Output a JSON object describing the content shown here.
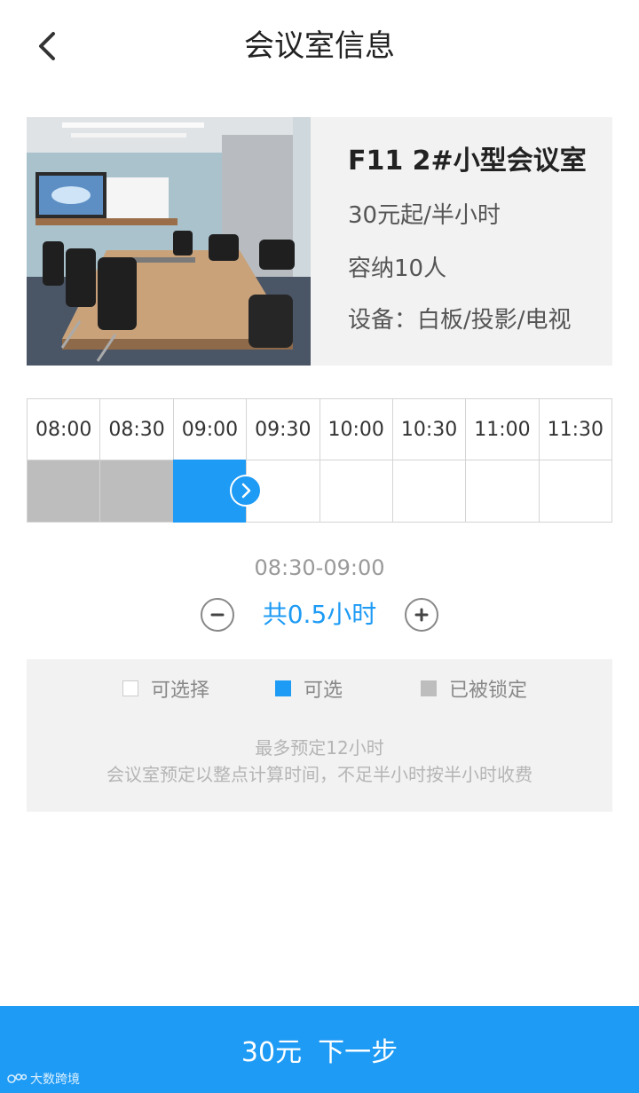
{
  "header": {
    "title": "会议室信息"
  },
  "room": {
    "name": "F11 2#小型会议室",
    "price": "30元起/半小时",
    "capacity": "容纳10人",
    "equipment": "设备：白板/投影/电视"
  },
  "time_slots": {
    "labels": [
      "08:00",
      "08:30",
      "09:00",
      "09:30",
      "10:00",
      "10:30",
      "11:00",
      "11:30"
    ],
    "states": [
      "locked",
      "locked",
      "selected",
      "free",
      "free",
      "free",
      "free",
      "free"
    ]
  },
  "selection": {
    "range": "08:30-09:00",
    "duration": "共0.5小时"
  },
  "legend": {
    "free": "可选择",
    "selected": "可选",
    "locked": "已被锁定"
  },
  "notes": {
    "max": "最多预定12小时",
    "rule": "会议室预定以整点计算时间，不足半小时按半小时收费"
  },
  "footer": {
    "price": "30元",
    "next": "下一步"
  },
  "watermark": "大数跨境",
  "colors": {
    "accent": "#1e9bf5",
    "locked": "#bdbdbd",
    "panel": "#f2f2f2"
  }
}
